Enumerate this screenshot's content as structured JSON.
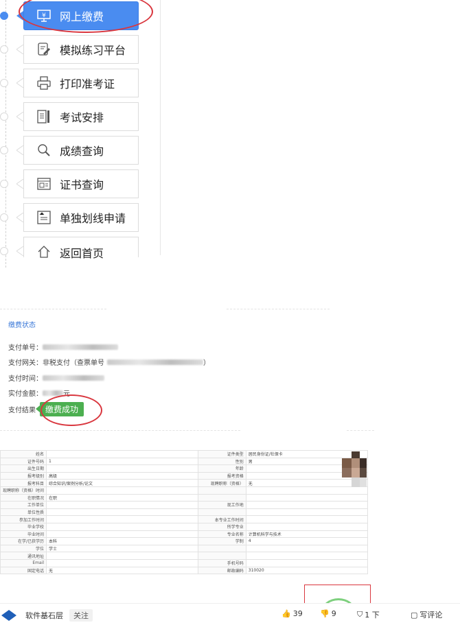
{
  "menu": {
    "items": [
      {
        "label": "网上缴费",
        "icon": "payment-terminal-icon",
        "active": true
      },
      {
        "label": "模拟练习平台",
        "icon": "edit-document-icon"
      },
      {
        "label": "打印准考证",
        "icon": "printer-icon"
      },
      {
        "label": "考试安排",
        "icon": "schedule-document-icon"
      },
      {
        "label": "成绩查询",
        "icon": "magnifier-icon"
      },
      {
        "label": "证书查询",
        "icon": "certificate-icon"
      },
      {
        "label": "单独划线申请",
        "icon": "application-form-icon"
      },
      {
        "label": "返回首页",
        "icon": "home-icon"
      }
    ]
  },
  "payment": {
    "title": "缴费状态",
    "order_label": "支付单号：",
    "gateway_label": "支付网关：",
    "gateway_value": "非税支付（查票单号",
    "gateway_suffix": "）",
    "time_label": "支付时间：",
    "amount_label": "实付金额：",
    "amount_suffix": "元",
    "result_label": "支付结果",
    "result_value": "缴费成功"
  },
  "info_table": {
    "rows": [
      [
        "姓名",
        "",
        "证件类型",
        "居民身份证/社保卡"
      ],
      [
        "证件号码",
        "1",
        "性别",
        "男"
      ],
      [
        "出生日期",
        "",
        "年龄",
        ""
      ],
      [
        "报考级别",
        "高级",
        "报考资格",
        ""
      ],
      [
        "报考科目",
        "综合知识/案例分析/论文",
        "现聘职称（资格）",
        "无"
      ],
      [
        "现聘职称（资格）时间",
        "",
        "",
        ""
      ],
      [
        "在职情况",
        "在职",
        "",
        ""
      ],
      [
        "工作单位",
        "",
        "现工作地",
        ""
      ],
      [
        "单位性质",
        "",
        "",
        ""
      ],
      [
        "参加工作时间",
        "",
        "本专业工作时间",
        ""
      ],
      [
        "毕业学校",
        "",
        "所学专业",
        ""
      ],
      [
        "毕业时间",
        "",
        "专业名称",
        "计算机科学与技术"
      ],
      [
        "在学/已获学历",
        "本科",
        "学制",
        "4"
      ],
      [
        "学位",
        "学士",
        "",
        ""
      ],
      [
        "通讯地址",
        "",
        "",
        ""
      ],
      [
        "Email",
        "",
        "手机号码",
        ""
      ],
      [
        "固定电话",
        "无",
        "邮政编码",
        "310020"
      ]
    ]
  },
  "bottom_bar": {
    "brand": "软件基石层",
    "follow": "关注",
    "like_count": "39",
    "dislike_count": "9",
    "collect": "1 下",
    "comment": "写评论"
  },
  "colors": {
    "accent_blue": "#4a8cf0",
    "success_green": "#4caf50",
    "highlight_red": "#d9363e"
  }
}
